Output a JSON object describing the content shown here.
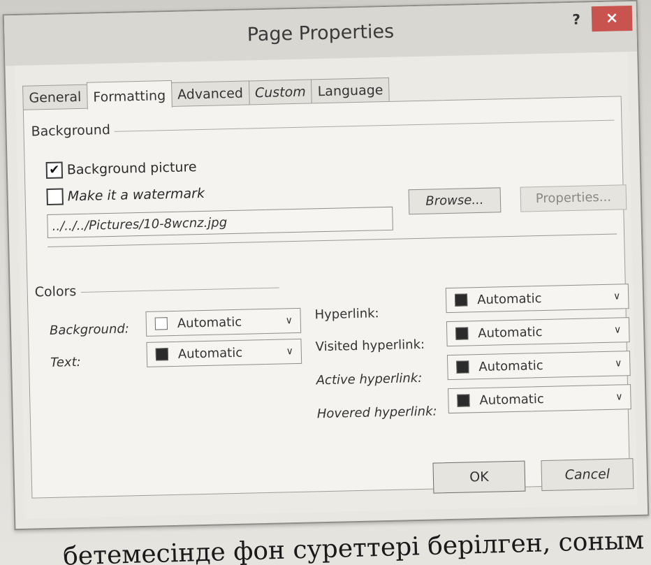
{
  "dialog": {
    "title": "Page Properties",
    "help_label": "?",
    "close_label": "×"
  },
  "tabs": [
    {
      "label": "General",
      "active": false
    },
    {
      "label": "Formatting",
      "active": true
    },
    {
      "label": "Advanced",
      "active": false
    },
    {
      "label": "Custom",
      "active": false
    },
    {
      "label": "Language",
      "active": false
    }
  ],
  "background_group": {
    "label": "Background",
    "background_picture": {
      "label": "Background picture",
      "checked": true
    },
    "watermark": {
      "label": "Make it a watermark",
      "checked": false
    },
    "path_value": "../../../Pictures/10-8wcnz.jpg",
    "browse_label": "Browse...",
    "properties_label": "Properties..."
  },
  "colors_group": {
    "label": "Colors",
    "background": {
      "label": "Background:",
      "value": "Automatic",
      "swatch": "#ffffff"
    },
    "text": {
      "label": "Text:",
      "value": "Automatic",
      "swatch": "#2b2b2b"
    },
    "hyperlink": {
      "label": "Hyperlink:",
      "value": "Automatic",
      "swatch": "#2b2b2b"
    },
    "visited_hyperlink": {
      "label": "Visited hyperlink:",
      "value": "Automatic",
      "swatch": "#2b2b2b"
    },
    "active_hyperlink": {
      "label": "Active hyperlink:",
      "value": "Automatic",
      "swatch": "#2b2b2b"
    },
    "hovered_hyperlink": {
      "label": "Hovered hyperlink:",
      "value": "Automatic",
      "swatch": "#2b2b2b"
    }
  },
  "footer": {
    "ok_label": "OK",
    "cancel_label": "Cancel"
  },
  "caption": "бетемесінде фон суреттері берілген, соным"
}
